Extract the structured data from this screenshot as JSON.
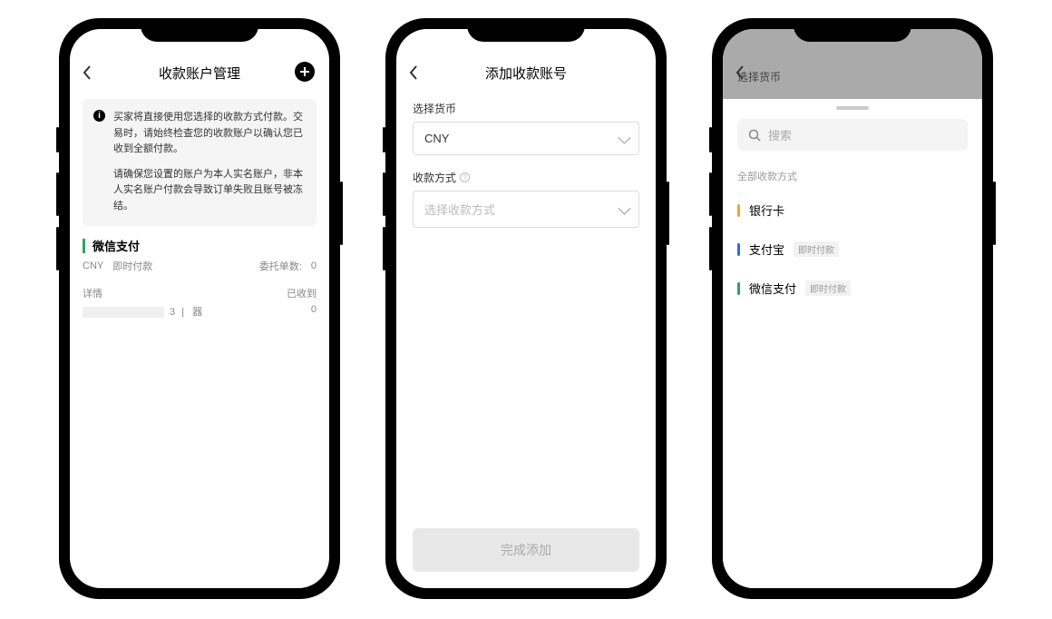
{
  "screen1": {
    "title": "收款账户管理",
    "notice_p1": "买家将直接使用您选择的收款方式付款。交易时，请始终检查您的收款账户以确认您已收到全额付款。",
    "notice_p2": "请确保您设置的账户为本人实名账户，非本人实名账户付款会导致订单失败且账号被冻结。",
    "method_name": "微信支付",
    "currency": "CNY",
    "instant": "即时付款",
    "delegate_label": "委托单数:",
    "delegate_count": "0",
    "detail_label": "详情",
    "received_label": "已收到",
    "received_count": "0",
    "redact_tail": "3",
    "redact_icon": "器"
  },
  "screen2": {
    "title": "添加收款账号",
    "currency_label": "选择货币",
    "currency_value": "CNY",
    "method_label": "收款方式",
    "method_placeholder": "选择收款方式",
    "submit": "完成添加"
  },
  "screen3": {
    "sheet_title": "选择货币",
    "search_placeholder": "搜索",
    "section": "全部收款方式",
    "opt1": "银行卡",
    "opt2": "支付宝",
    "opt3": "微信支付",
    "instant_tag": "即时付款"
  }
}
